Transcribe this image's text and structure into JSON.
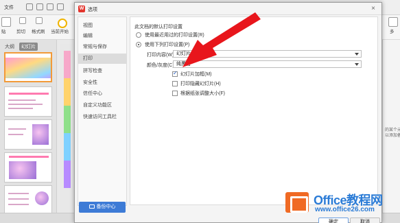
{
  "app": {
    "menu_label": "文件",
    "ribbon": {
      "paste": "贴",
      "cut": "剪切",
      "format_painter": "格式刷",
      "from_current": "当前开始",
      "right_label": "多"
    },
    "pane_tabs": [
      "大纲",
      "幻灯片"
    ],
    "right_pane_text": "的某个元\n以添加备"
  },
  "dialog": {
    "title": "选项",
    "close": "×",
    "nav": [
      {
        "label": "视图",
        "active": false
      },
      {
        "label": "编辑",
        "active": false
      },
      {
        "label": "常规与保存",
        "active": false
      },
      {
        "label": "打印",
        "active": true
      },
      {
        "label": "拼写检查",
        "active": false
      },
      {
        "label": "安全性",
        "active": false
      },
      {
        "label": "信任中心",
        "active": false
      },
      {
        "label": "自定义功能区",
        "active": false
      },
      {
        "label": "快速访问工具栏",
        "active": false
      }
    ],
    "backup_center": "备份中心",
    "section_title": "此文档的默认打印设置",
    "radio_recent": {
      "label": "使用最近用过的打印设置(R)",
      "checked": false
    },
    "radio_following": {
      "label": "使用下列打印设置(P)",
      "checked": true
    },
    "print_content": {
      "label": "打印内容(W):",
      "value": "幻灯片"
    },
    "color_mode": {
      "label": "颜色/灰度(C):",
      "value": "纯黑白"
    },
    "checkboxes": [
      {
        "label": "幻灯片加框(M)",
        "checked": true
      },
      {
        "label": "打印隐藏幻灯片(H)",
        "checked": false
      },
      {
        "label": "根据纸张调整大小(F)",
        "checked": false
      }
    ],
    "ok_label": "确定",
    "cancel_label": "取消"
  },
  "watermark": {
    "brand": "Office教程网",
    "url": "www.office26.com"
  },
  "colors": {
    "accent_blue": "#3d7bd6",
    "arrow_red": "#e8161c",
    "watermark_orange": "#f06a24"
  }
}
